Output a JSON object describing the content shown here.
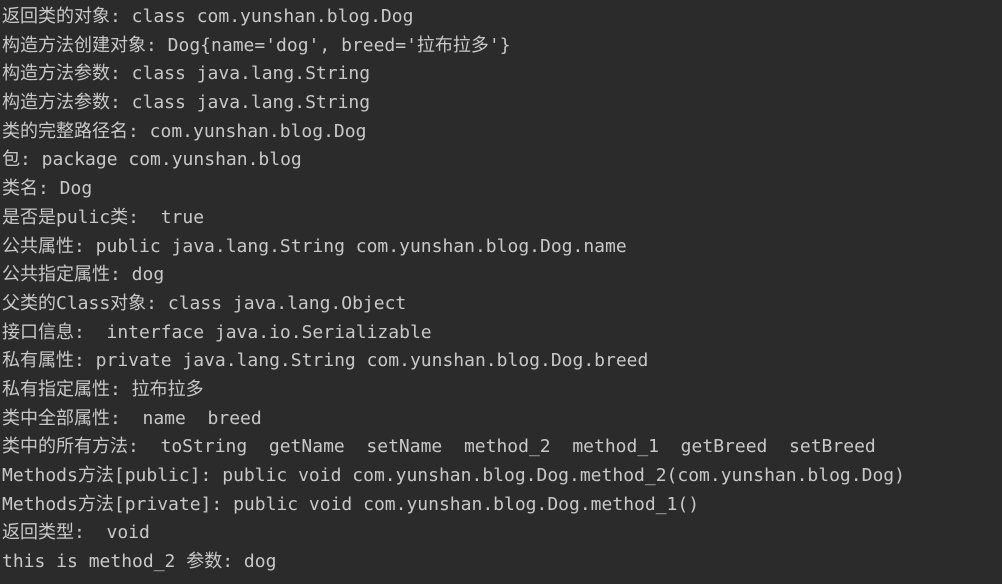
{
  "console": {
    "lines": [
      "返回类的对象: class com.yunshan.blog.Dog",
      "构造方法创建对象: Dog{name='dog', breed='拉布拉多'}",
      "构造方法参数: class java.lang.String",
      "构造方法参数: class java.lang.String",
      "类的完整路径名: com.yunshan.blog.Dog",
      "包: package com.yunshan.blog",
      "类名: Dog",
      "是否是pulic类:  true",
      "公共属性: public java.lang.String com.yunshan.blog.Dog.name",
      "公共指定属性: dog",
      "父类的Class对象: class java.lang.Object",
      "接口信息:  interface java.io.Serializable",
      "私有属性: private java.lang.String com.yunshan.blog.Dog.breed",
      "私有指定属性: 拉布拉多",
      "类中全部属性:  name  breed",
      "类中的所有方法:  toString  getName  setName  method_2  method_1  getBreed  setBreed",
      "Methods方法[public]: public void com.yunshan.blog.Dog.method_2(com.yunshan.blog.Dog)",
      "Methods方法[private]: public void com.yunshan.blog.Dog.method_1()",
      "返回类型:  void",
      "this is method_2 参数: dog"
    ]
  }
}
